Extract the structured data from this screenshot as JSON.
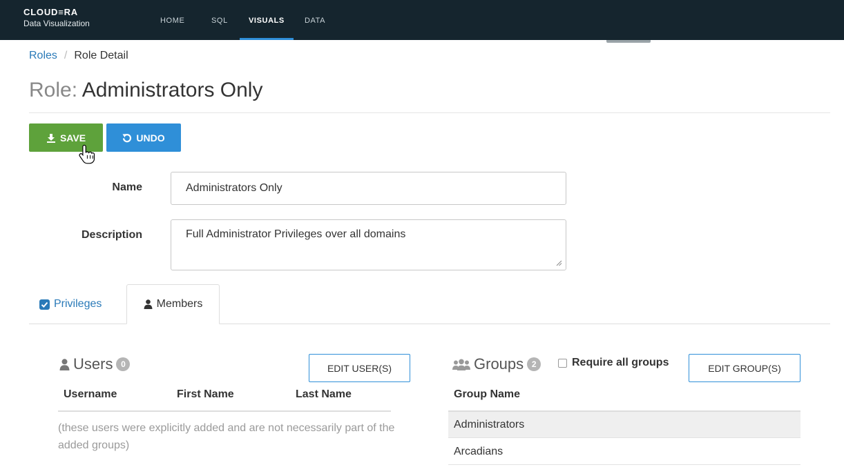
{
  "brand": {
    "name": "CLOUD≡RA",
    "subtitle": "Data Visualization"
  },
  "nav": {
    "items": [
      {
        "label": "HOME",
        "active": false
      },
      {
        "label": "SQL",
        "active": false
      },
      {
        "label": "VISUALS",
        "active": true
      },
      {
        "label": "DATA",
        "active": false
      }
    ]
  },
  "breadcrumb": {
    "parent": "Roles",
    "separator": "/",
    "current": "Role Detail"
  },
  "page": {
    "title_prefix": "Role:",
    "title_name": "Administrators Only"
  },
  "toolbar": {
    "save_label": "SAVE",
    "undo_label": "UNDO"
  },
  "form": {
    "name_label": "Name",
    "name_value": "Administrators Only",
    "description_label": "Description",
    "description_value": "Full Administrator Privileges over all domains"
  },
  "tabs": [
    {
      "label": "Privileges",
      "icon": "checkbox-checked-icon",
      "active": false
    },
    {
      "label": "Members",
      "icon": "user-icon",
      "active": true
    }
  ],
  "users": {
    "title": "Users",
    "count": "0",
    "edit_button": "EDIT USER(S)",
    "columns": [
      "Username",
      "First Name",
      "Last Name"
    ],
    "note": "(these users were explicitly added and are not necessarily part of the added groups)"
  },
  "groups": {
    "title": "Groups",
    "count": "2",
    "require_all_label": "Require all groups",
    "require_all_checked": false,
    "edit_button": "EDIT GROUP(S)",
    "column": "Group Name",
    "rows": [
      "Administrators",
      "Arcadians"
    ]
  },
  "colors": {
    "topbar": "#15252e",
    "save": "#5ea23b",
    "primary": "#2f8fd8",
    "link": "#2a7ab8",
    "badge": "#b5b5b5"
  }
}
